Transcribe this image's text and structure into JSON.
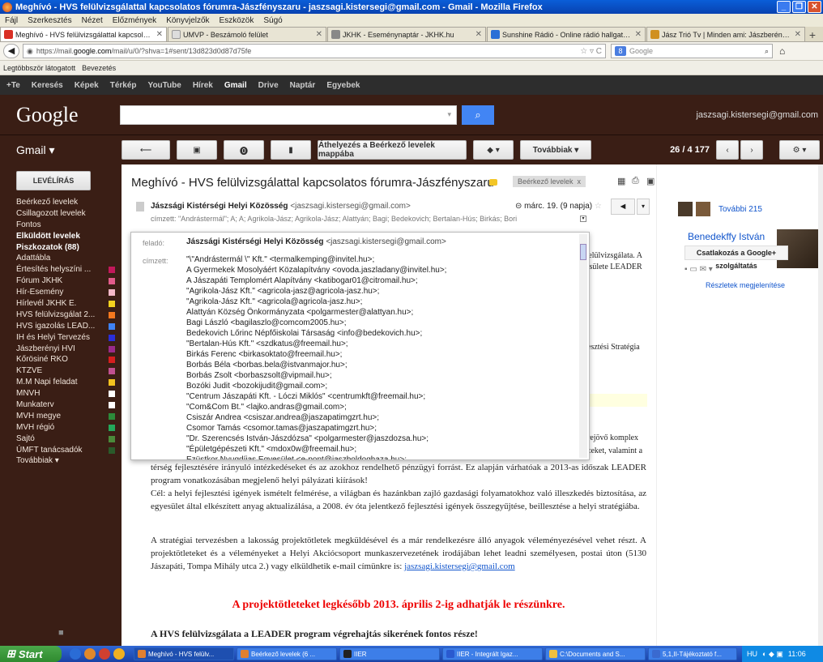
{
  "window": {
    "title": "Meghívó - HVS felülvizsgálattal kapcsolatos fórumra-Jászfényszaru - jaszsagi.kistersegi@gmail.com - Gmail - Mozilla Firefox"
  },
  "menu": [
    "Fájl",
    "Szerkesztés",
    "Nézet",
    "Előzmények",
    "Könyvjelzők",
    "Eszközök",
    "Súgó"
  ],
  "tabs": [
    {
      "label": "Meghívó - HVS felülvizsgálattal kapcsolat...",
      "color": "#d93025"
    },
    {
      "label": "UMVP - Beszámoló felület",
      "color": "#cccccc"
    },
    {
      "label": "JKHK - Eseménynaptár - JKHK.hu",
      "color": "#888888"
    },
    {
      "label": "Sunshine Rádió - Online rádió hallgatás - ...",
      "color": "#2a6fd6"
    },
    {
      "label": "Jász Trió Tv | Minden ami: Jászberény, J...",
      "color": "#d09020"
    }
  ],
  "urlbar": {
    "prefix": "https://mail.",
    "host": "google.com",
    "path": "/mail/u/0/?shva=1#sent/13d823d0d87d75fe",
    "search_placeholder": "Google"
  },
  "bookmarks": [
    "Legtöbbször látogatott",
    "Bevezetés"
  ],
  "gbar": [
    "+Te",
    "Keresés",
    "Képek",
    "Térkép",
    "YouTube",
    "Hírek",
    "Gmail",
    "Drive",
    "Naptár",
    "Egyebek"
  ],
  "header": {
    "logo": "Google",
    "email": "jaszsagi.kistersegi@gmail.com"
  },
  "toolbar": {
    "gmail_label": "Gmail",
    "move_label": "Áthelyezés a Beérkező levelek mappába",
    "more_label": "Továbbiak",
    "page_count": "26 / 4 177"
  },
  "sidebar": {
    "compose": "LEVÉLÍRÁS",
    "folders": [
      {
        "label": "Beérkező levelek",
        "bold": false,
        "color": ""
      },
      {
        "label": "Csillagozott levelek",
        "bold": false,
        "color": ""
      },
      {
        "label": "Fontos",
        "bold": false,
        "color": ""
      },
      {
        "label": "Elküldött levelek",
        "bold": true,
        "color": ""
      },
      {
        "label": "Piszkozatok (88)",
        "bold": true,
        "color": ""
      },
      {
        "label": "Adattábla",
        "bold": false,
        "color": ""
      },
      {
        "label": "Értesítés helyszíni ...",
        "bold": false,
        "color": "#c2185b"
      },
      {
        "label": "Fórum JKHK",
        "bold": false,
        "color": "#e25b8b"
      },
      {
        "label": "Hír-Esemény",
        "bold": false,
        "color": "#f4b8c8"
      },
      {
        "label": "Hírlevél JKHK E.",
        "bold": false,
        "color": "#f5d21f"
      },
      {
        "label": "HVS felülvizsgálat 2...",
        "bold": false,
        "color": "#f4781e"
      },
      {
        "label": "HVS igazolás LEAD...",
        "bold": false,
        "color": "#3f82f6"
      },
      {
        "label": "IH és Helyi Tervezés",
        "bold": false,
        "color": "#2a2ed8"
      },
      {
        "label": "Jászberényi HVI",
        "bold": false,
        "color": "#9a2a8a"
      },
      {
        "label": "Kőrösiné RKO",
        "bold": false,
        "color": "#d61e1e"
      },
      {
        "label": "KTZVE",
        "bold": false,
        "color": "#c05090"
      },
      {
        "label": "M.M Napi feladat",
        "bold": false,
        "color": "#f4c21f"
      },
      {
        "label": "MNVH",
        "bold": false,
        "color": "#ffffff"
      },
      {
        "label": "Munkaterv",
        "bold": false,
        "color": "#ffffff"
      },
      {
        "label": "MVH megye",
        "bold": false,
        "color": "#2c8a3a"
      },
      {
        "label": "MVH régió",
        "bold": false,
        "color": "#23a85a"
      },
      {
        "label": "Sajtó",
        "bold": false,
        "color": "#4a8a3a"
      },
      {
        "label": "ÚMFT tanácsadók",
        "bold": false,
        "color": "#2a5a2a"
      },
      {
        "label": "Továbbiak ▾",
        "bold": false,
        "color": ""
      }
    ]
  },
  "message": {
    "subject": "Meghívó - HVS felülvizsgálattal kapcsolatos fórumra-Jászfényszaru",
    "label_chip": "Beérkező levelek",
    "sender_name": "Jászsági Kistérségi Helyi Közösség",
    "sender_email": "<jaszsagi.kistersegi@gmail.com>",
    "date": "márc. 19. (9 napja)",
    "to_brief": "címzett: \"Andrástermál\"; A; A; Agrikola-Jász; Agrikola-Jász; Alattyán; Bagi; Bedekovich; Bertalan-Hús; Birkás; Bori",
    "paragraph1": "térség fejlesztésére irányuló intézkedéseket és az azokhoz rendelhető pénzügyi forrást. Ez alapján várhatóak a 2013-as időszak LEADER program vonatkozásában megjelenő helyi pályázati kiírások!",
    "paragraph2": "Cél: a helyi fejlesztési igények ismételt felmérése, a világban és hazánkban zajló gazdasági folyamatokhoz való illeszkedés biztosítása, az egyesület által elkészített anyag aktualizálása, a 2008. év óta jelentkező fejlesztési igények összegyűjtése, beillesztése a helyi stratégiába.",
    "paragraph3": "A stratégiai tervezésben a lakosság projektötletek megküldésével és a már rendelkezésre álló anyagok véleményezésével vehet részt. A projektötleteket és a véleményeket a Helyi Akciócsoport munkaszervezetének irodájában lehet leadni személyesen, postai úton (5130 Jászapáti, Tompa Mihály utca 2.) vagy elküldhetik e-mail címünkre is:",
    "paragraph3_link": "jaszsagi.kistersegi@gmail.com",
    "red_line": "A projektötleteket legkésőbb 2013. április 2-ig adhatják le részünkre.",
    "bold_line": "A HVS felülvizsgálata a LEADER program végrehajtás sikerének fontos része!",
    "behind1": "felülvizsgálata. A",
    "behind2": "esülete LEADER",
    "behind3": "esztési Stratégia",
    "behind4": "rejövő komplex",
    "behind5": "zeket, valamint a"
  },
  "popup": {
    "from_label": "feladó:",
    "to_label": "címzett:",
    "from_name": "Jászsági Kistérségi Helyi Közösség",
    "from_email": "<jaszsagi.kistersegi@gmail.com>",
    "recipients": [
      "\"\\\"Andrástermál \\\" Kft.\" <termalkemping@invitel.hu>;",
      "A Gyermekek Mosolyáért Közalapítvány <ovoda.jaszladany@invitel.hu>;",
      "A Jászapáti Templomért Alapítvány <katibogar01@citromail.hu>;",
      "\"Agrikola-Jász Kft.\" <agricola-jasz@agricola-jasz.hu>;",
      "\"Agrikola-Jász Kft.\" <agricola@agricola-jasz.hu>;",
      "Alattyán Község Önkormányzata <polgarmester@alattyan.hu>;",
      "Bagi László <bagilaszlo@comcom2005.hu>;",
      "Bedekovich Lőrinc Népfőiskolai Társaság <info@bedekovich.hu>;",
      "\"Bertalan-Hús Kft.\" <szdkatus@freemail.hu>;",
      "Birkás Ferenc <birkasoktato@freemail.hu>;",
      "Borbás Béla <borbas.bela@istvanmajor.hu>;",
      "Borbás Zsolt <borbaszsolt@vipmail.hu>;",
      "Bozóki Judit <bozokijudit@gmail.com>;",
      "\"Centrum Jászapáti Kft. - Lóczi Miklós\" <centrumkft@freemail.hu>;",
      "\"Com&Com Bt.\" <lajko.andras@gmail.com>;",
      "Csiszár Andrea <csiszar.andrea@jaszapatimgzrt.hu>;",
      "Csomor Tamás <csomor.tamas@jaszapatimgzrt.hu>;",
      "\"Dr. Szerencsés István-Jászdózsa\" <polgarmester@jaszdozsa.hu>;",
      "\"Épületgépészeti Kft.\" <mdox0w@freemail.hu>;",
      "Ezüstkor Nyugdíjas Egyesület <e-pont@jaszboldoghaza.hu>;"
    ]
  },
  "right": {
    "more_people": "További 215",
    "person_name": "Benedekffy István",
    "join": "Csatlakozás a Google+ szolgáltatás",
    "details": "Részletek megjelenítése"
  },
  "taskbar": {
    "start": "Start",
    "tasks": [
      "Meghívó - HVS felülv...",
      "Beérkező levelek (6 ...",
      "IIER",
      "IIER - Integrált Igaz...",
      "C:\\Documents and S...",
      "5,1,II-Tájékoztató f..."
    ],
    "lang": "HU",
    "clock": "11:06"
  }
}
